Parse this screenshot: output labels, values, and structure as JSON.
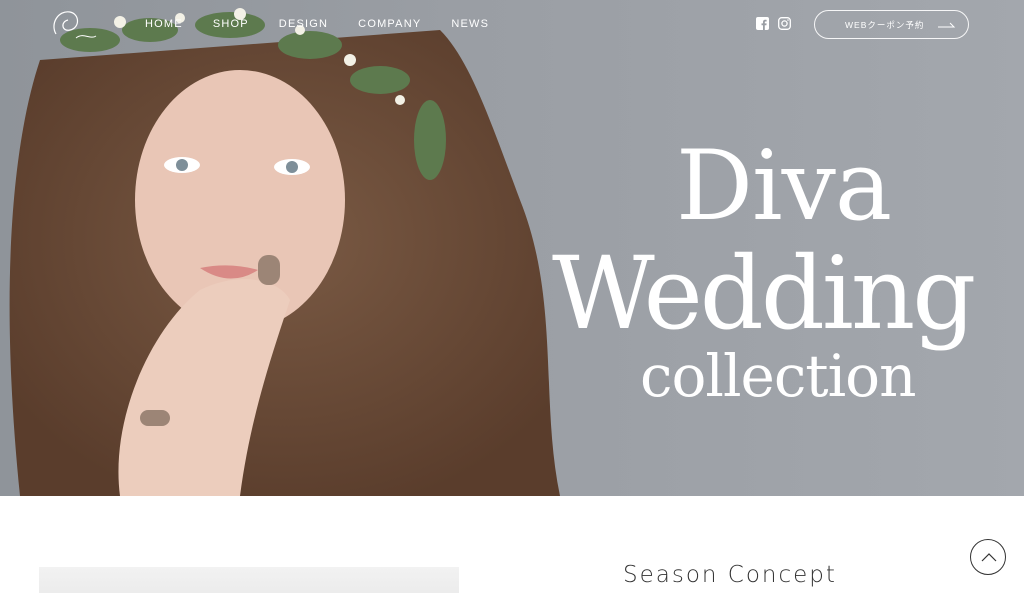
{
  "nav": {
    "items": [
      {
        "label": "HOME"
      },
      {
        "label": "SHOP"
      },
      {
        "label": "DESIGN"
      },
      {
        "label": "COMPANY"
      },
      {
        "label": "NEWS"
      }
    ]
  },
  "social": {
    "icons": [
      "facebook-icon",
      "instagram-icon"
    ]
  },
  "coupon": {
    "label": "WEBクーポン予約"
  },
  "hero": {
    "title_line1": "Diva",
    "title_line2": "Wedding",
    "title_line3": "collection"
  },
  "section": {
    "heading": "Season Concept"
  },
  "colors": {
    "hero_bg": "#9a9ea4",
    "text_white": "#ffffff",
    "heading": "#333333"
  }
}
